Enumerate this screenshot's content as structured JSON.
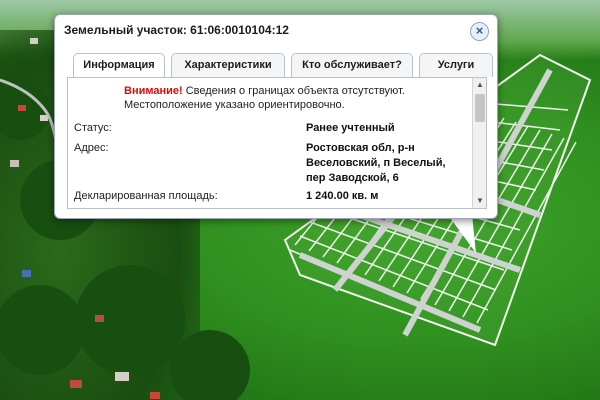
{
  "popup": {
    "title": "Земельный участок: 61:06:0010104:12",
    "close_icon": "×"
  },
  "tabs": [
    {
      "label": "Информация",
      "active": true
    },
    {
      "label": "Характеристики",
      "active": false
    },
    {
      "label": "Кто обслуживает?",
      "active": false
    },
    {
      "label": "Услуги",
      "active": false
    }
  ],
  "notice": {
    "warning_label": "Внимание!",
    "line1_rest": " Сведения о границах объекта отсутствуют.",
    "line2": "Местоположение указано ориентировочно."
  },
  "info": {
    "status_label": "Статус:",
    "status_value": "Ранее учтенный",
    "address_label": "Адрес:",
    "address_line1": "Ростовская обл, р-н",
    "address_line2": "Веселовский, п Веселый,",
    "address_line3": "пер Заводской, 6",
    "area_label": "Декларированная площадь:",
    "area_value": "1 240.00 кв. м"
  },
  "scrollbar": {
    "up_icon": "▲",
    "down_icon": "▼"
  }
}
